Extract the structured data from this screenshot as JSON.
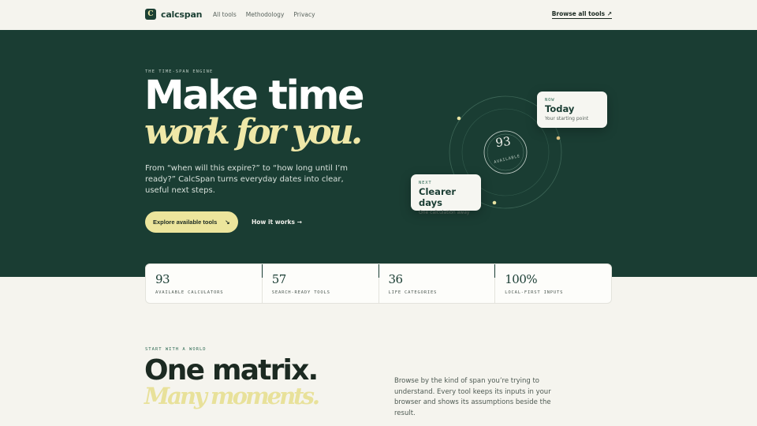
{
  "header": {
    "logo_mark": "C",
    "brand": "calcspan",
    "nav": [
      "All tools",
      "Methodology",
      "Privacy"
    ],
    "browse_label": "Browse all tools ↗"
  },
  "hero": {
    "eyebrow": "THE TIME-SPAN ENGINE",
    "title_line1": "Make time",
    "title_line2": "work for you.",
    "description": "From “when will this expire?” to “how long until I’m ready?” CalcSpan turns everyday dates into clear, useful next steps.",
    "cta_label": "Explore available tools",
    "cta_arrow": "↘",
    "secondary_link": "How it works →",
    "orbit": {
      "number": "93",
      "label": "AVAILABLE"
    },
    "card_now": {
      "kicker": "NOW",
      "title": "Today",
      "subtitle": "Your starting point"
    },
    "card_next": {
      "kicker": "NEXT",
      "title": "Clearer days",
      "subtitle": "One calculation away"
    }
  },
  "stats": [
    {
      "value": "93",
      "label": "AVAILABLE CALCULATORS"
    },
    {
      "value": "57",
      "label": "SEARCH-READY TOOLS"
    },
    {
      "value": "36",
      "label": "LIFE CATEGORIES"
    },
    {
      "value": "100%",
      "label": "LOCAL-FIRST INPUTS"
    }
  ],
  "section": {
    "eyebrow": "START WITH A WORLD",
    "title_line1": "One matrix.",
    "title_line2": "Many moments.",
    "description": "Browse by the kind of span you’re trying to understand. Every tool keeps its inputs in your browser and shows its assumptions beside the result."
  },
  "colors": {
    "hero_bg": "#1a3d33",
    "accent": "#ece59c",
    "page_bg": "#f5f4ee",
    "brand": "#1c4034"
  }
}
